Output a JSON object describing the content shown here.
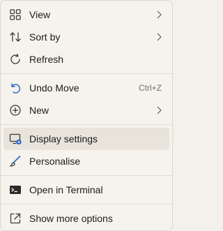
{
  "menu": {
    "items": [
      {
        "label": "View",
        "icon": "view-icon",
        "has_submenu": true
      },
      {
        "label": "Sort by",
        "icon": "sort-icon",
        "has_submenu": true
      },
      {
        "label": "Refresh",
        "icon": "refresh-icon",
        "has_submenu": false
      },
      {
        "label": "Undo Move",
        "icon": "undo-icon",
        "shortcut": "Ctrl+Z"
      },
      {
        "label": "New",
        "icon": "new-icon",
        "has_submenu": true
      },
      {
        "label": "Display settings",
        "icon": "display-settings-icon",
        "highlighted": true
      },
      {
        "label": "Personalise",
        "icon": "brush-icon"
      },
      {
        "label": "Open in Terminal",
        "icon": "terminal-icon"
      },
      {
        "label": "Show more options",
        "icon": "show-more-icon"
      }
    ]
  },
  "colors": {
    "accent": "#2563c9",
    "background": "#f6f3ed",
    "highlight": "#e8e4dc",
    "text": "#1b1b1b"
  }
}
